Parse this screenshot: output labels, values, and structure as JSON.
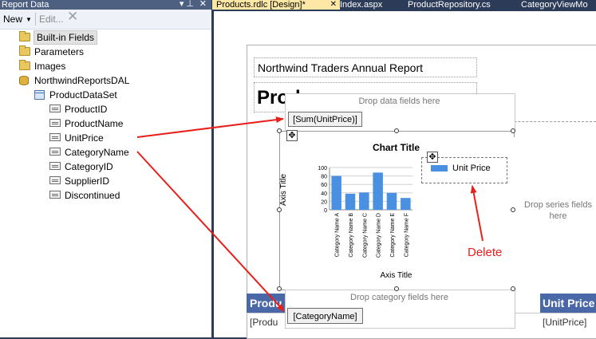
{
  "panel": {
    "title": "Report Data",
    "toolbar": {
      "new_label": "New",
      "edit_label": "Edit..."
    },
    "tree": [
      {
        "label": "Built-in Fields",
        "icon": "folder-icon"
      },
      {
        "label": "Parameters",
        "icon": "folder-icon"
      },
      {
        "label": "Images",
        "icon": "folder-icon"
      },
      {
        "label": "NorthwindReportsDAL",
        "icon": "database-icon"
      },
      {
        "label": "ProductDataSet",
        "icon": "dataset-icon"
      },
      {
        "label": "ProductID",
        "icon": "field-icon"
      },
      {
        "label": "ProductName",
        "icon": "field-icon"
      },
      {
        "label": "UnitPrice",
        "icon": "field-icon"
      },
      {
        "label": "CategoryName",
        "icon": "field-icon"
      },
      {
        "label": "CategoryID",
        "icon": "field-icon"
      },
      {
        "label": "SupplierID",
        "icon": "field-icon"
      },
      {
        "label": "Discontinued",
        "icon": "field-icon"
      }
    ]
  },
  "tabs": [
    "Products.rdlc [Design]*",
    "Index.aspx",
    "ProductRepository.cs",
    "CategoryViewMo"
  ],
  "report": {
    "title": "Northwind Traders Annual Report",
    "subtitle": "Prod",
    "table_header_left": "Produ",
    "table_header_right": "Unit Price",
    "table_cell_left": "[Produ",
    "table_cell_right": "[UnitPrice]"
  },
  "chart_zones": {
    "data_hint": "Drop data fields here",
    "data_field": "[Sum(UnitPrice)]",
    "series_hint": "Drop series fields here",
    "category_hint": "Drop category fields here",
    "category_field": "[CategoryName]"
  },
  "annotation": {
    "delete_label": "Delete"
  },
  "colors": {
    "accent": "#4a67a7",
    "bar": "#4a90e2",
    "arrow": "#e8201c"
  },
  "chart_data": {
    "type": "bar",
    "title": "Chart Title",
    "xlabel": "Axis Title",
    "ylabel": "Axis Title",
    "categories": [
      "Category Name A",
      "Category Name B",
      "Category Name C",
      "Category Name D",
      "Category Name E",
      "Category Name F"
    ],
    "series": [
      {
        "name": "Unit Price",
        "values": [
          80,
          38,
          41,
          88,
          40,
          28
        ]
      }
    ],
    "ylim": [
      0,
      100
    ],
    "yticks": [
      0,
      20,
      40,
      60,
      80,
      100
    ],
    "grid": true,
    "legend": "top-right"
  }
}
